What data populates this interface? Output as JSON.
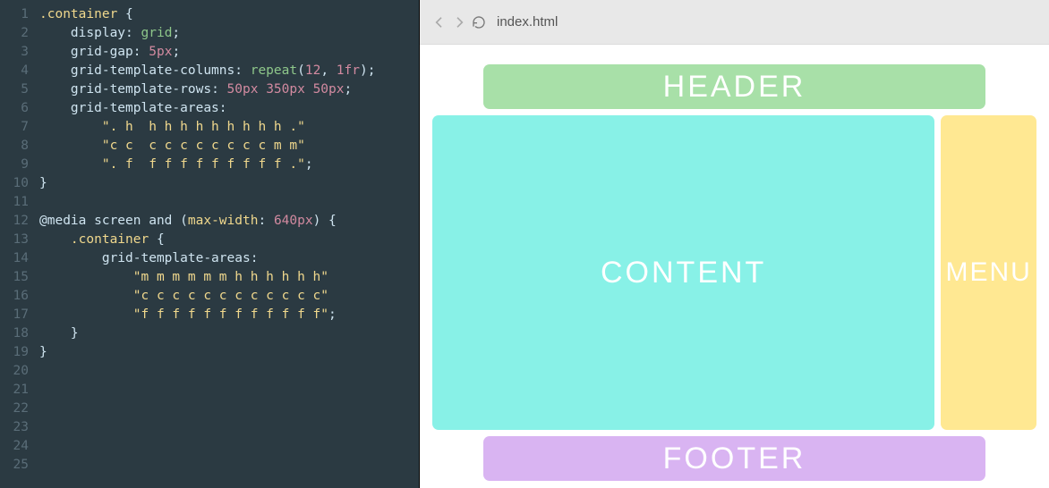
{
  "editor": {
    "line_count": 25,
    "lines": [
      {
        "html": "<span class='c-sel'>.container</span><span class='c-punc'> {</span>"
      },
      {
        "html": "    <span class='c-prop'>display</span><span class='c-punc'>:</span> <span class='c-kw'>grid</span><span class='c-punc'>;</span>"
      },
      {
        "html": "    <span class='c-prop'>grid-gap</span><span class='c-punc'>:</span> <span class='c-num'>5px</span><span class='c-punc'>;</span>"
      },
      {
        "html": "    <span class='c-prop'>grid-template-columns</span><span class='c-punc'>:</span> <span class='c-kw'>repeat</span><span class='c-punc'>(</span><span class='c-num'>12</span><span class='c-punc'>, </span><span class='c-num'>1fr</span><span class='c-punc'>);</span>"
      },
      {
        "html": "    <span class='c-prop'>grid-template-rows</span><span class='c-punc'>:</span> <span class='c-num'>50px</span> <span class='c-num'>350px</span> <span class='c-num'>50px</span><span class='c-punc'>;</span>"
      },
      {
        "html": "    <span class='c-prop'>grid-template-areas</span><span class='c-punc'>:</span>"
      },
      {
        "html": "        <span class='c-str'>\". h  h h h h h h h h h .\"</span>"
      },
      {
        "html": "        <span class='c-str'>\"c c  c c c c c c c c m m\"</span>"
      },
      {
        "html": "        <span class='c-str'>\". f  f f f f f f f f f .\"</span><span class='c-punc'>;</span>"
      },
      {
        "html": "<span class='c-punc'>}</span>"
      },
      {
        "html": ""
      },
      {
        "html": "<span class='c-at'>@media screen </span><span class='c-and'>and</span><span class='c-punc'> (</span><span class='c-cond'>max-width</span><span class='c-punc'>: </span><span class='c-num'>640px</span><span class='c-punc'>) {</span>"
      },
      {
        "html": "    <span class='c-sel'>.container</span><span class='c-punc'> {</span>"
      },
      {
        "html": "        <span class='c-prop'>grid-template-areas</span><span class='c-punc'>:</span>"
      },
      {
        "html": "            <span class='c-str'>\"m m m m m m h h h h h h\"</span>"
      },
      {
        "html": "            <span class='c-str'>\"c c c c c c c c c c c c\"</span>"
      },
      {
        "html": "            <span class='c-str'>\"f f f f f f f f f f f f\"</span><span class='c-punc'>;</span>"
      },
      {
        "html": "    <span class='c-punc'>}</span>"
      },
      {
        "html": "<span class='c-punc'>}</span>"
      },
      {
        "html": ""
      },
      {
        "html": ""
      },
      {
        "html": ""
      },
      {
        "html": ""
      },
      {
        "html": ""
      },
      {
        "html": ""
      }
    ]
  },
  "browser": {
    "url": "index.html",
    "areas": {
      "header": "HEADER",
      "content": "CONTENT",
      "menu": "MENU",
      "footer": "FOOTER"
    }
  }
}
